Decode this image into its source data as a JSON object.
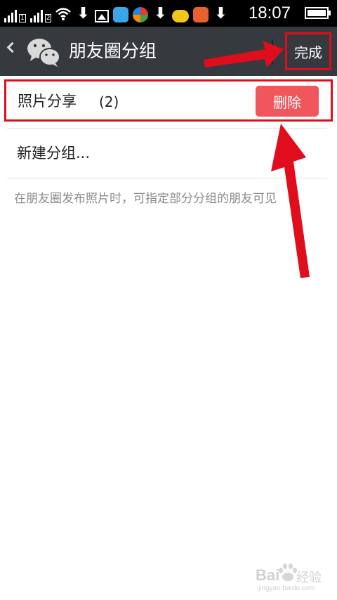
{
  "status_bar": {
    "time": "18:07",
    "signal_1_sim": "1",
    "signal_2_sim": "2",
    "icons": [
      "signal-icon",
      "signal-icon",
      "wifi-icon",
      "download-icon",
      "image-icon",
      "app-icon",
      "app-icon",
      "download-icon",
      "weather-alert-icon",
      "app-icon",
      "download-icon",
      "battery-icon"
    ]
  },
  "header": {
    "title": "朋友圈分组",
    "done_label": "完成"
  },
  "groups": [
    {
      "name": "照片分享",
      "count": "(2)",
      "delete_label": "删除"
    }
  ],
  "new_group_label": "新建分组...",
  "hint": "在朋友圈发布照片时，可指定部分分组的朋友可见",
  "watermark": {
    "brand": "Bai",
    "brand_suffix": "经验",
    "url": "jingyan.baidu.com"
  },
  "colors": {
    "title_bar": "#363a3e",
    "delete_button": "#f0575c",
    "annotation": "#e00d1c"
  }
}
